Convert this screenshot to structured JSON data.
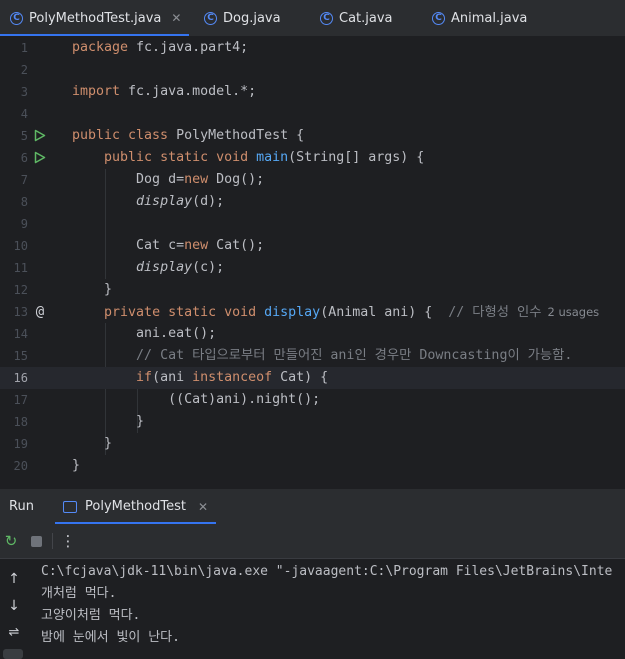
{
  "tabs": [
    {
      "label": "PolyMethodTest.java",
      "active": true,
      "closable": true
    },
    {
      "label": "Dog.java"
    },
    {
      "label": "Cat.java"
    },
    {
      "label": "Animal.java"
    }
  ],
  "editor": {
    "current_line": "16",
    "lines": [
      {
        "n": "1",
        "segs": [
          [
            "kw",
            "package "
          ],
          [
            "",
            "fc.java.part4;"
          ]
        ]
      },
      {
        "n": "2",
        "segs": []
      },
      {
        "n": "3",
        "segs": [
          [
            "kw",
            "import "
          ],
          [
            "",
            "fc.java.model.*;"
          ]
        ]
      },
      {
        "n": "4",
        "segs": []
      },
      {
        "n": "5",
        "gutter": "run",
        "segs": [
          [
            "kw",
            "public class "
          ],
          [
            "",
            "PolyMethodTest {"
          ]
        ]
      },
      {
        "n": "6",
        "gutter": "run",
        "segs": [
          [
            "",
            "    "
          ],
          [
            "kw",
            "public static void "
          ],
          [
            "fn",
            "main"
          ],
          [
            "",
            "(String[] args) {"
          ]
        ]
      },
      {
        "n": "7",
        "segs": [
          [
            "",
            "        Dog d="
          ],
          [
            "kw",
            "new "
          ],
          [
            "",
            "Dog();"
          ]
        ]
      },
      {
        "n": "8",
        "segs": [
          [
            "",
            "        "
          ],
          [
            "it",
            "display"
          ],
          [
            "",
            "(d);"
          ]
        ]
      },
      {
        "n": "9",
        "segs": []
      },
      {
        "n": "10",
        "segs": [
          [
            "",
            "        Cat c="
          ],
          [
            "kw",
            "new "
          ],
          [
            "",
            "Cat();"
          ]
        ]
      },
      {
        "n": "11",
        "segs": [
          [
            "",
            "        "
          ],
          [
            "it",
            "display"
          ],
          [
            "",
            "(c);"
          ]
        ]
      },
      {
        "n": "12",
        "segs": [
          [
            "",
            "    }"
          ]
        ]
      },
      {
        "n": "13",
        "gutter": "at",
        "segs": [
          [
            "",
            "    "
          ],
          [
            "kw",
            "private static void "
          ],
          [
            "fn",
            "display"
          ],
          [
            "",
            "(Animal ani) {  "
          ],
          [
            "cm",
            "// 다형성 인수"
          ],
          [
            "hint",
            "2 usages"
          ]
        ]
      },
      {
        "n": "14",
        "segs": [
          [
            "",
            "        ani.eat();"
          ]
        ]
      },
      {
        "n": "15",
        "segs": [
          [
            "",
            "        "
          ],
          [
            "cm",
            "// Cat 타입으로부터 만들어진 ani인 경우만 Downcasting이 가능함."
          ]
        ]
      },
      {
        "n": "16",
        "segs": [
          [
            "",
            "        "
          ],
          [
            "kw",
            "if"
          ],
          [
            "",
            "(ani "
          ],
          [
            "kw",
            "instanceof "
          ],
          [
            "",
            "Cat) {"
          ]
        ]
      },
      {
        "n": "17",
        "segs": [
          [
            "",
            "            ((Cat)ani).night();"
          ]
        ]
      },
      {
        "n": "18",
        "segs": [
          [
            "",
            "        }"
          ]
        ]
      },
      {
        "n": "19",
        "segs": [
          [
            "",
            "    }"
          ]
        ]
      },
      {
        "n": "20",
        "segs": [
          [
            "",
            "}"
          ]
        ]
      }
    ]
  },
  "run_panel": {
    "title": "Run",
    "tab_label": "PolyMethodTest",
    "icons": [
      "rerun-icon",
      "stop-icon",
      "more-icon"
    ],
    "side_icons": [
      "up-arrow-icon",
      "down-arrow-icon",
      "soft-wrap-icon"
    ],
    "output": [
      "C:\\fcjava\\jdk-11\\bin\\java.exe \"-javaagent:C:\\Program Files\\JetBrains\\Inte",
      "개처럼 먹다.",
      "고양이처럼 먹다.",
      "밤에 눈에서 빛이 난다."
    ]
  },
  "colors": {
    "bg": "#1e1f22",
    "keyword": "#cf8e6d",
    "function": "#56a8f5",
    "comment": "#7a7e85",
    "text": "#bcbec4",
    "accent": "#3574f0",
    "run": "#5fb865"
  }
}
